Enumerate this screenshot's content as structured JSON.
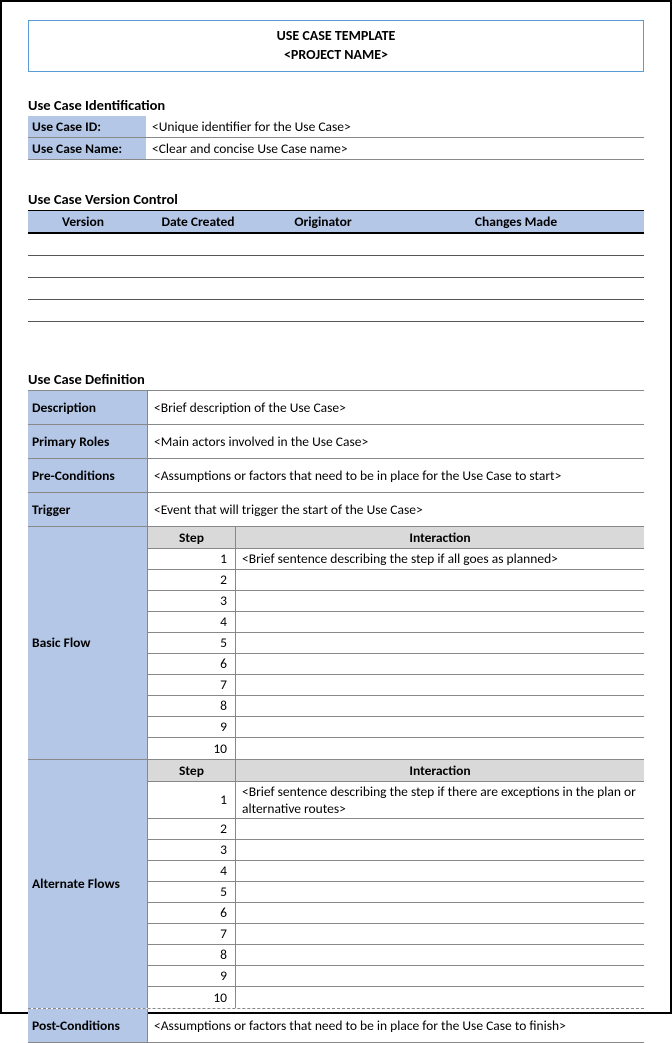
{
  "title": {
    "line1": "USE CASE TEMPLATE",
    "line2": "<PROJECT NAME>"
  },
  "identification": {
    "heading": "Use Case Identification",
    "idLabel": "Use Case ID:",
    "idValue": "<Unique identifier for the Use Case>",
    "nameLabel": "Use Case Name:",
    "nameValue": "<Clear and concise Use Case name>"
  },
  "version": {
    "heading": "Use Case Version Control",
    "cols": {
      "c1": "Version",
      "c2": "Date Created",
      "c3": "Originator",
      "c4": "Changes Made"
    }
  },
  "definition": {
    "heading": "Use Case Definition",
    "desc": {
      "label": "Description",
      "value": "<Brief description of the Use Case>"
    },
    "roles": {
      "label": "Primary Roles",
      "value": "<Main actors involved in the Use Case>"
    },
    "pre": {
      "label": "Pre-Conditions",
      "value": "<Assumptions or factors that need to be in place for the Use Case to start>"
    },
    "trigger": {
      "label": "Trigger",
      "value": "<Event that will trigger the start of the Use Case>"
    },
    "basic": {
      "label": "Basic Flow",
      "stepHead": "Step",
      "interHead": "Interaction",
      "steps": {
        "s1n": "1",
        "s1t": "<Brief sentence describing the step if all goes as planned>",
        "s2n": "2",
        "s2t": "",
        "s3n": "3",
        "s3t": "",
        "s4n": "4",
        "s4t": "",
        "s5n": "5",
        "s5t": "",
        "s6n": "6",
        "s6t": "",
        "s7n": "7",
        "s7t": "",
        "s8n": "8",
        "s8t": "",
        "s9n": "9",
        "s9t": "",
        "s10n": "10",
        "s10t": ""
      }
    },
    "alt": {
      "label": "Alternate Flows",
      "stepHead": "Step",
      "interHead": "Interaction",
      "steps": {
        "s1n": "1",
        "s1t": "<Brief sentence describing the step if there are exceptions in the plan or alternative routes>",
        "s2n": "2",
        "s2t": "",
        "s3n": "3",
        "s3t": "",
        "s4n": "4",
        "s4t": "",
        "s5n": "5",
        "s5t": "",
        "s6n": "6",
        "s6t": "",
        "s7n": "7",
        "s7t": "",
        "s8n": "8",
        "s8t": "",
        "s9n": "9",
        "s9t": "",
        "s10n": "10",
        "s10t": ""
      }
    },
    "post": {
      "label": "Post-Conditions",
      "value": "<Assumptions or factors that need to be in place for the Use Case to finish>"
    }
  }
}
